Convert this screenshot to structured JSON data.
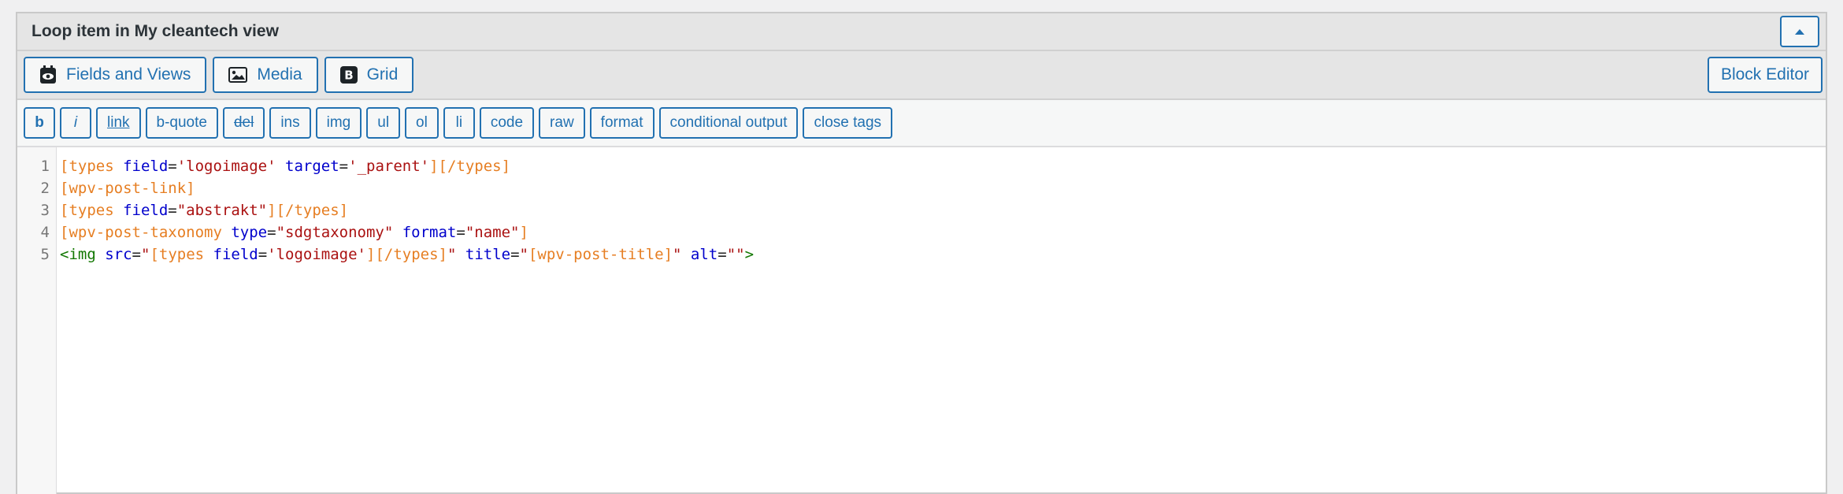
{
  "panel": {
    "title": "Loop item in My cleantech view"
  },
  "tabs": [
    {
      "label": "Fields and Views",
      "icon": "fields-views-icon"
    },
    {
      "label": "Media",
      "icon": "media-icon"
    },
    {
      "label": "Grid",
      "icon": "bootstrap-icon"
    }
  ],
  "block_editor_label": "Block Editor",
  "quicktags": [
    "b",
    "i",
    "link",
    "b-quote",
    "del",
    "ins",
    "img",
    "ul",
    "ol",
    "li",
    "code",
    "raw",
    "format",
    "conditional output",
    "close tags"
  ],
  "editor": {
    "line_numbers": [
      "1",
      "2",
      "3",
      "4",
      "5"
    ],
    "lines": [
      [
        {
          "t": "[types ",
          "c": "t-shortcode"
        },
        {
          "t": "field",
          "c": "t-attr"
        },
        {
          "t": "=",
          "c": "t-plain"
        },
        {
          "t": "'logoimage'",
          "c": "t-str"
        },
        {
          "t": " ",
          "c": "t-plain"
        },
        {
          "t": "target",
          "c": "t-attr"
        },
        {
          "t": "=",
          "c": "t-plain"
        },
        {
          "t": "'_parent'",
          "c": "t-str"
        },
        {
          "t": "][/types]",
          "c": "t-shortcode"
        }
      ],
      [
        {
          "t": "[wpv-post-link]",
          "c": "t-shortcode"
        }
      ],
      [
        {
          "t": "[types ",
          "c": "t-shortcode"
        },
        {
          "t": "field",
          "c": "t-attr"
        },
        {
          "t": "=",
          "c": "t-plain"
        },
        {
          "t": "\"abstrakt\"",
          "c": "t-str"
        },
        {
          "t": "][/types]",
          "c": "t-shortcode"
        }
      ],
      [
        {
          "t": "[wpv-post-taxonomy ",
          "c": "t-shortcode"
        },
        {
          "t": "type",
          "c": "t-attr"
        },
        {
          "t": "=",
          "c": "t-plain"
        },
        {
          "t": "\"sdgtaxonomy\"",
          "c": "t-str"
        },
        {
          "t": " ",
          "c": "t-plain"
        },
        {
          "t": "format",
          "c": "t-attr"
        },
        {
          "t": "=",
          "c": "t-plain"
        },
        {
          "t": "\"name\"",
          "c": "t-str"
        },
        {
          "t": "]",
          "c": "t-shortcode"
        }
      ],
      [
        {
          "t": "<img ",
          "c": "t-tag"
        },
        {
          "t": "src",
          "c": "t-attr"
        },
        {
          "t": "=",
          "c": "t-plain"
        },
        {
          "t": "\"",
          "c": "t-str"
        },
        {
          "t": "[types ",
          "c": "t-shortcode"
        },
        {
          "t": "field",
          "c": "t-attr"
        },
        {
          "t": "=",
          "c": "t-plain"
        },
        {
          "t": "'logoimage'",
          "c": "t-str"
        },
        {
          "t": "][/types]",
          "c": "t-shortcode"
        },
        {
          "t": "\"",
          "c": "t-str"
        },
        {
          "t": " ",
          "c": "t-plain"
        },
        {
          "t": "title",
          "c": "t-attr"
        },
        {
          "t": "=",
          "c": "t-plain"
        },
        {
          "t": "\"",
          "c": "t-str"
        },
        {
          "t": "[wpv-post-title]",
          "c": "t-shortcode"
        },
        {
          "t": "\"",
          "c": "t-str"
        },
        {
          "t": " ",
          "c": "t-plain"
        },
        {
          "t": "alt",
          "c": "t-attr"
        },
        {
          "t": "=",
          "c": "t-plain"
        },
        {
          "t": "\"\"",
          "c": "t-str"
        },
        {
          "t": ">",
          "c": "t-tag"
        }
      ]
    ]
  },
  "colors": {
    "accent": "#2271b1",
    "shortcode": "#e67e22",
    "attribute": "#0000cc",
    "string": "#aa1111",
    "tag": "#117700"
  }
}
